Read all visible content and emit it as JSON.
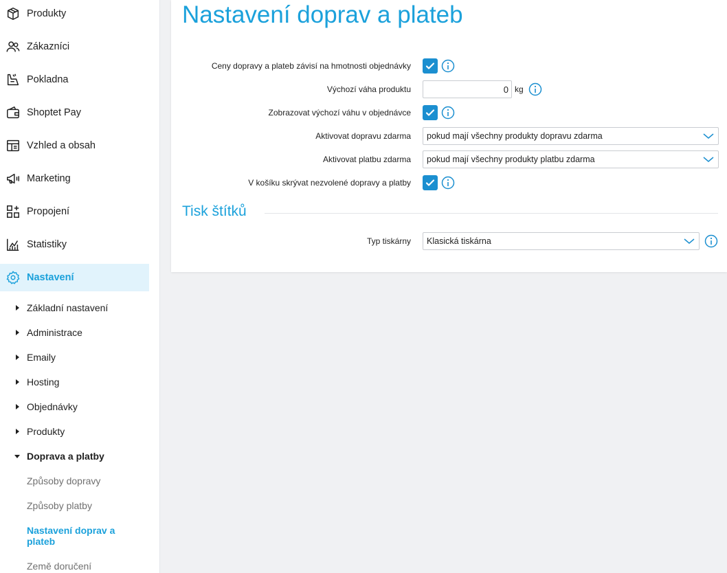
{
  "sidebar": {
    "items": [
      {
        "label": "Produkty",
        "icon": "box-icon"
      },
      {
        "label": "Zákazníci",
        "icon": "users-icon"
      },
      {
        "label": "Pokladna",
        "icon": "cash-register-icon"
      },
      {
        "label": "Shoptet Pay",
        "icon": "wallet-icon"
      },
      {
        "label": "Vzhled a obsah",
        "icon": "layout-icon"
      },
      {
        "label": "Marketing",
        "icon": "megaphone-icon"
      },
      {
        "label": "Propojení",
        "icon": "apps-plus-icon"
      },
      {
        "label": "Statistiky",
        "icon": "chart-icon"
      },
      {
        "label": "Nastavení",
        "icon": "gear-icon"
      }
    ],
    "sub_items": [
      {
        "label": "Základní nastavení"
      },
      {
        "label": "Administrace"
      },
      {
        "label": "Emaily"
      },
      {
        "label": "Hosting"
      },
      {
        "label": "Objednávky"
      },
      {
        "label": "Produkty"
      },
      {
        "label": "Doprava a platby"
      }
    ],
    "subsub_items": [
      {
        "label": "Způsoby dopravy"
      },
      {
        "label": "Způsoby platby"
      },
      {
        "label": "Nastavení doprav a plateb"
      },
      {
        "label": "Země doručení"
      }
    ]
  },
  "main": {
    "title": "Nastavení doprav a plateb",
    "rows": {
      "weight_dependent": {
        "label": "Ceny dopravy a plateb závisí na hmotnosti objednávky",
        "checked": true
      },
      "default_weight": {
        "label": "Výchozí váha produktu",
        "value": "0",
        "unit": "kg"
      },
      "show_weight": {
        "label": "Zobrazovat výchozí váhu v objednávce",
        "checked": true
      },
      "free_shipping": {
        "label": "Aktivovat dopravu zdarma",
        "value": "pokud mají všechny produkty dopravu zdarma"
      },
      "free_payment": {
        "label": "Aktivovat platbu zdarma",
        "value": "pokud mají všechny produkty platbu zdarma"
      },
      "hide_unselected": {
        "label": "V košíku skrývat nezvolené dopravy a platby",
        "checked": true
      }
    },
    "section_title": "Tisk štítků",
    "printer": {
      "label": "Typ tiskárny",
      "value": "Klasická tiskárna"
    }
  },
  "colors": {
    "accent": "#1ba1db",
    "checkbox": "#1b8fd0",
    "active_bg": "#e1f3fc"
  }
}
